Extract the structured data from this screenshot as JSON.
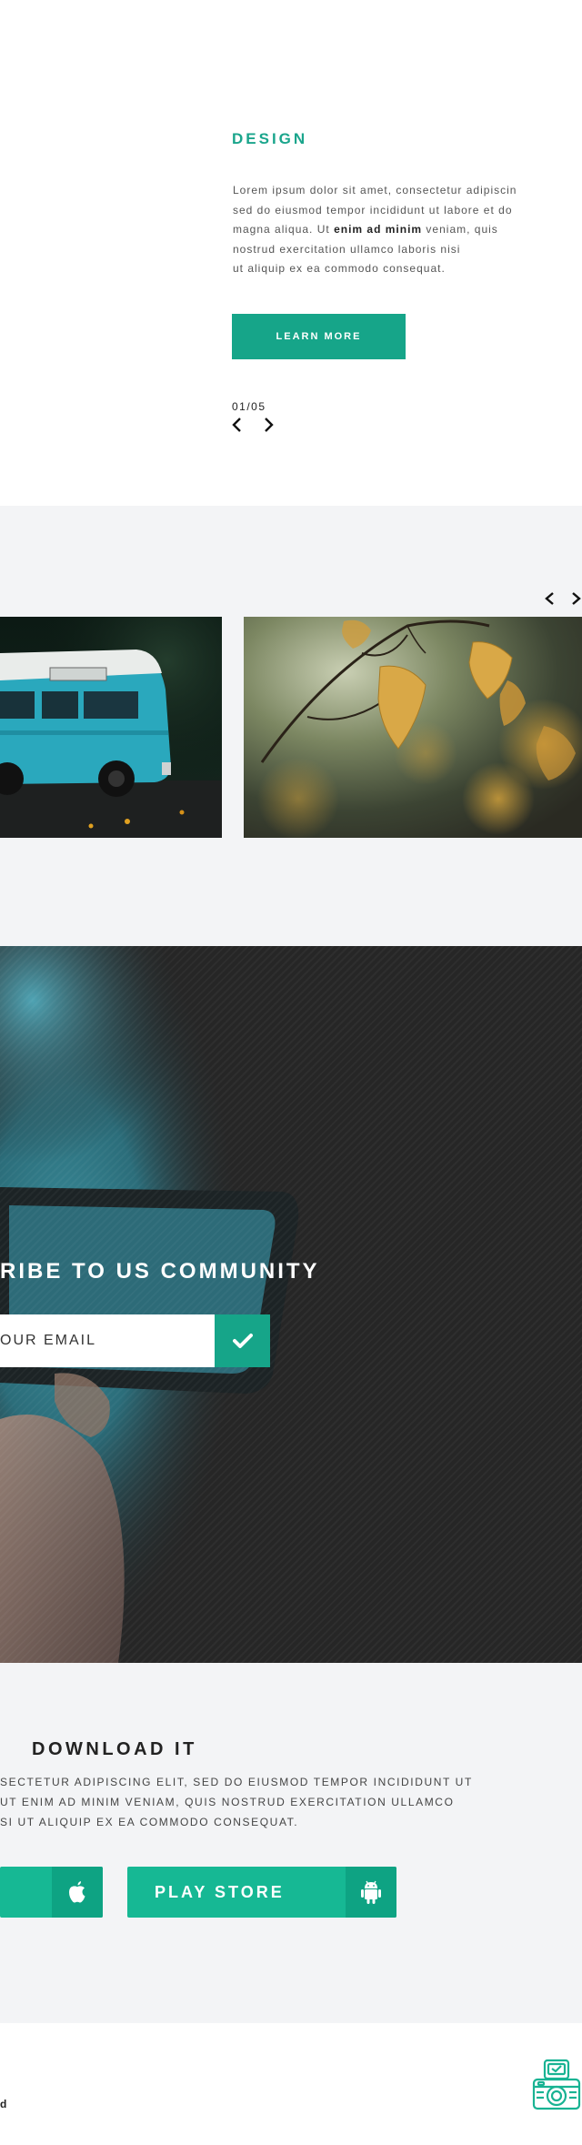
{
  "design": {
    "title": "DESIGN",
    "body_lines": [
      "Lorem ipsum dolor sit amet, consectetur adipiscin",
      "sed do eiusmod tempor incididunt ut labore et do",
      {
        "before": "magna aliqua. Ut ",
        "bold": "enim ad minim",
        "after": " veniam, quis"
      },
      "nostrud exercitation ullamco laboris nisi",
      "ut aliquip ex ea commodo consequat."
    ],
    "button_label": "LEARN MORE",
    "counter": "01/05"
  },
  "gallery": {
    "photos": [
      "van-photo",
      "autumn-leaves-photo"
    ]
  },
  "subscribe": {
    "title": "RIBE TO US COMMUNITY",
    "email_placeholder": "OUR EMAIL"
  },
  "download": {
    "title": "DOWNLOAD IT",
    "body_lines": [
      "SECTETUR ADIPISCING ELIT, SED DO EIUSMOD TEMPOR INCIDIDUNT UT",
      "UT ENIM AD MINIM VENIAM, QUIS NOSTRUD EXERCITATION ULLAMCO",
      "SI UT ALIQUIP EX EA COMMODO CONSEQUAT."
    ],
    "store_buttons": [
      {
        "label": "",
        "icon": "apple-icon"
      },
      {
        "label": "PLAY STORE",
        "icon": "android-icon"
      }
    ]
  },
  "footer": {
    "text": "d",
    "logo_icon": "camera-logo-icon"
  },
  "colors": {
    "accent": "#16a589",
    "store_button": "#16b894",
    "section_bg": "#f3f4f6",
    "dark_bg": "#262626"
  }
}
